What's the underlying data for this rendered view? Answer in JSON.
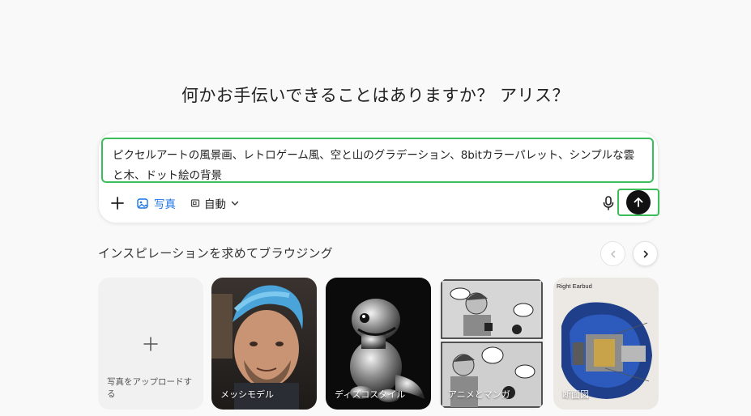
{
  "greeting": "何かお手伝いできることはありますか？ アリス？",
  "composer": {
    "prompt_text": "ピクセルアートの風景画、レトロゲーム風、空と山のグラデーション、8bitカラーパレット、シンプルな雲と木、ドット絵の背景",
    "add_icon": "plus-icon",
    "photo_label": "写真",
    "photo_icon": "image-icon",
    "mode_label": "自動",
    "mode_icon": "aspect-ratio-icon",
    "mic_icon": "microphone-icon",
    "send_icon": "arrow-up-icon"
  },
  "inspiration": {
    "title": "インスピレーションを求めてブラウジング",
    "cards": [
      {
        "label": "写真をアップロードする",
        "icon": "plus-icon"
      },
      {
        "label": "メッシモデル"
      },
      {
        "label": "ディスコスタイル"
      },
      {
        "label": "アニメとマンガ"
      },
      {
        "label": "断面図",
        "overlay_text": "Right Earbud"
      }
    ]
  },
  "colors": {
    "accent_blue": "#1a73e8",
    "highlight_green": "#3bbd5a",
    "send_bg": "#111111"
  }
}
